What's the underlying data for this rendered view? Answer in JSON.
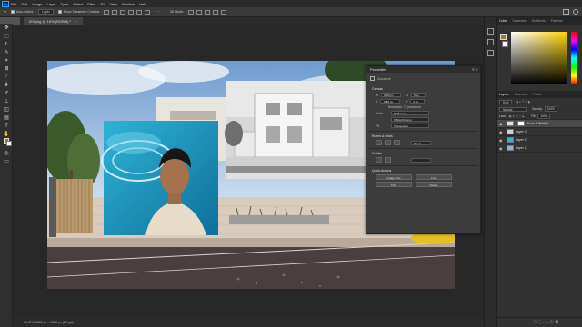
{
  "app": {
    "logo": "Ps"
  },
  "menu": [
    "File",
    "Edit",
    "Image",
    "Layer",
    "Type",
    "Select",
    "Filter",
    "3D",
    "View",
    "Window",
    "Help"
  ],
  "options": {
    "auto_select_label": "Auto-Select:",
    "auto_select_value": "Layer",
    "show_transform_label": "Show Transform Controls",
    "mode_3d_label": "3D Mode:"
  },
  "document": {
    "tab_title": "t23.png @ 16% (RGB/8) *",
    "status": "16.67%    3000 px × 1688 px (72 ppi)"
  },
  "color_panel": {
    "tabs": [
      "Color",
      "Swatches",
      "Gradients",
      "Patterns"
    ],
    "active_tab": 0,
    "hue_color": "#ffd400"
  },
  "layers_panel": {
    "tabs": [
      "Layers",
      "Channels",
      "Paths"
    ],
    "active_tab": 0,
    "search_placeholder": "Kind",
    "blend": "Normal",
    "opacity_label": "Opacity:",
    "opacity": "100%",
    "lock_label": "Lock:",
    "fill_label": "Fill:",
    "fill": "100%",
    "layers": [
      {
        "name": "Black & White 1",
        "selected": true
      },
      {
        "name": "Layer 3",
        "selected": false
      },
      {
        "name": "Layer 2",
        "selected": false
      },
      {
        "name": "Layer 1",
        "selected": false
      }
    ]
  },
  "properties": {
    "title": "Properties",
    "doc_label": "Document",
    "canvas_section": "Canvas",
    "w_label": "W",
    "w_value": "3000 px",
    "h_label": "H",
    "h_value": "1688 px",
    "x_label": "X",
    "x_value": "0 px",
    "y_label": "Y",
    "y_value": "0 px",
    "resolution": "Resolution: 72 pixels/inch",
    "mode_label": "Mode",
    "mode_value": "RGB Color",
    "depth_value": "8 Bits/Channel",
    "fill_label": "Fill",
    "fill_value": "Transparent",
    "rulers_section": "Rulers & Grids",
    "rulers_unit": "Pixels",
    "guides_section": "Guides",
    "quick_section": "Quick Actions",
    "btn_image_size": "Image Size",
    "btn_crop": "Crop",
    "btn_trim": "Trim",
    "btn_rotate": "Rotate"
  }
}
